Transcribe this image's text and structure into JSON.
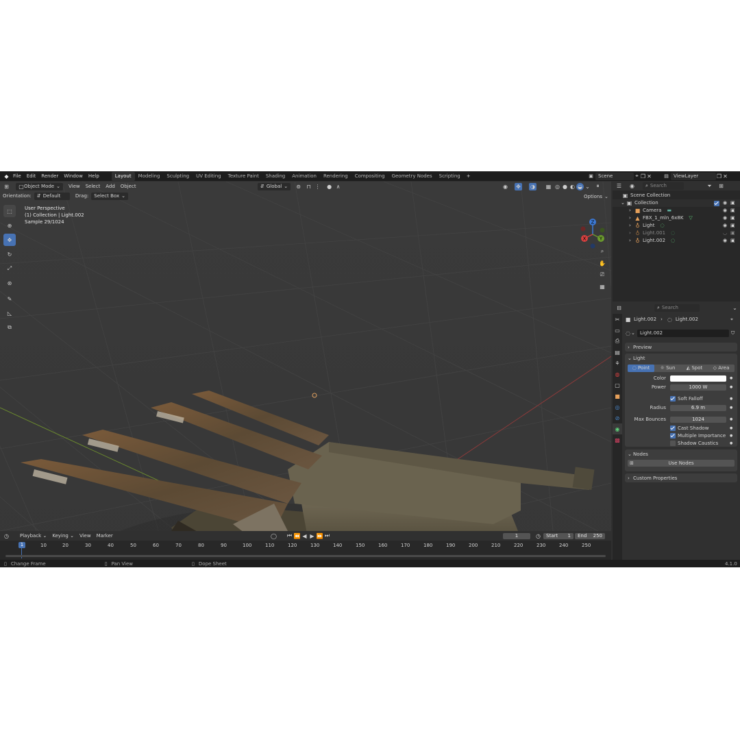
{
  "menu": {
    "items": [
      "File",
      "Edit",
      "Render",
      "Window",
      "Help"
    ],
    "workspaces": [
      "Layout",
      "Modeling",
      "Sculpting",
      "UV Editing",
      "Texture Paint",
      "Shading",
      "Animation",
      "Rendering",
      "Compositing",
      "Geometry Nodes",
      "Scripting"
    ],
    "active_workspace": "Layout",
    "add_tab": "+",
    "scene": "Scene",
    "view_layer": "ViewLayer"
  },
  "viewport_header": {
    "mode": "Object Mode",
    "view": "View",
    "select": "Select",
    "add": "Add",
    "object": "Object",
    "transform": "Global",
    "options": "Options"
  },
  "tool_settings": {
    "orientation_label": "Orientation:",
    "orientation": "Default",
    "drag_label": "Drag:",
    "drag": "Select Box"
  },
  "overlay": {
    "line1": "User Perspective",
    "line2": "(1) Collection | Light.002",
    "line3": "Sample 29/1024"
  },
  "gizmo": {
    "z": "Z",
    "y": "Y",
    "x": "X"
  },
  "outliner": {
    "search_placeholder": "Search",
    "scene_collection": "Scene Collection",
    "collection": "Collection",
    "items": [
      {
        "name": "Camera",
        "icon": "camera-icon",
        "color": "#e6a05a"
      },
      {
        "name": "FBX_1_mln_6x8K",
        "icon": "mesh-icon",
        "color": "#e6a05a"
      },
      {
        "name": "Light",
        "icon": "light-icon",
        "color": "#e6a05a"
      },
      {
        "name": "Light.001",
        "icon": "light-icon",
        "color": "#e6a05a"
      },
      {
        "name": "Light.002",
        "icon": "light-icon",
        "color": "#e6a05a"
      }
    ]
  },
  "properties": {
    "search_placeholder": "Search",
    "breadcrumb_object": "Light.002",
    "breadcrumb_data": "Light.002",
    "datablock": "Light.002",
    "preview": "Preview",
    "light_section": "Light",
    "types": [
      "Point",
      "Sun",
      "Spot",
      "Area"
    ],
    "active_type": "Point",
    "color_label": "Color",
    "color_value": "#ffffff",
    "power_label": "Power",
    "power": "1000 W",
    "soft_falloff": "Soft Falloff",
    "radius_label": "Radius",
    "radius": "6.9 m",
    "max_bounces_label": "Max Bounces",
    "max_bounces": "1024",
    "cast_shadow": "Cast Shadow",
    "multiple_importance": "Multiple Importance",
    "shadow_caustics": "Shadow Caustics",
    "nodes_section": "Nodes",
    "use_nodes": "Use Nodes",
    "custom_properties": "Custom Properties"
  },
  "timeline": {
    "playback": "Playback",
    "keying": "Keying",
    "view": "View",
    "marker": "Marker",
    "current_frame": "1",
    "start_label": "Start",
    "start": "1",
    "end_label": "End",
    "end": "250",
    "ticks": [
      "1",
      "10",
      "20",
      "30",
      "40",
      "50",
      "60",
      "70",
      "80",
      "90",
      "100",
      "110",
      "120",
      "130",
      "140",
      "150",
      "160",
      "170",
      "180",
      "190",
      "200",
      "210",
      "220",
      "230",
      "240",
      "250"
    ]
  },
  "status": {
    "change_frame": "Change Frame",
    "pan_view": "Pan View",
    "dope_sheet": "Dope Sheet",
    "version": "4.1.0"
  }
}
